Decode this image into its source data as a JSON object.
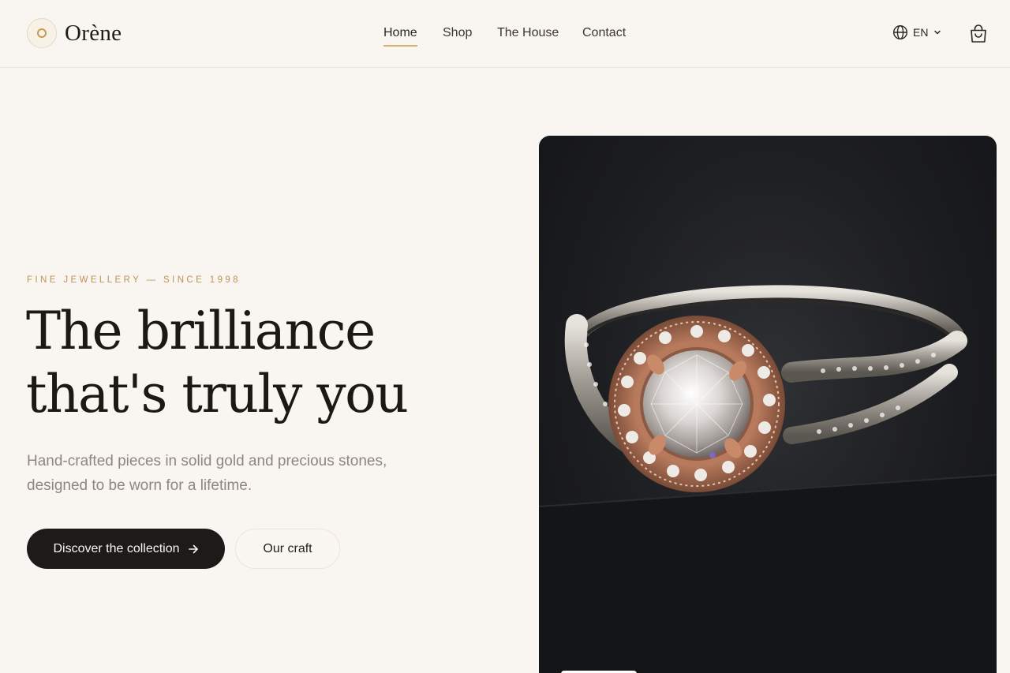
{
  "brand": {
    "name": "Orène"
  },
  "nav": {
    "items": [
      {
        "label": "Home",
        "active": true
      },
      {
        "label": "Shop",
        "active": false
      },
      {
        "label": "The House",
        "active": false
      },
      {
        "label": "Contact",
        "active": false
      }
    ]
  },
  "header": {
    "language": "EN",
    "icons": {
      "language": "globe-icon",
      "language_menu": "chevron-down-icon",
      "cart": "shopping-bag-icon"
    }
  },
  "hero": {
    "eyebrow": "FINE JEWELLERY — SINCE 1998",
    "headline": [
      "The brilliance",
      "that's truly you"
    ],
    "lede": [
      "Hand-crafted pieces in solid gold and precious stones,",
      "designed to be worn for a lifetime."
    ],
    "primary_cta": "Discover the collection",
    "secondary_cta": "Our craft",
    "image_subject": "halo-diamond-ring"
  },
  "colors": {
    "background": "#f9f5f0",
    "accent_gold": "#c59a58",
    "dark": "#1d1b19",
    "muted_text": "#8e8780"
  }
}
